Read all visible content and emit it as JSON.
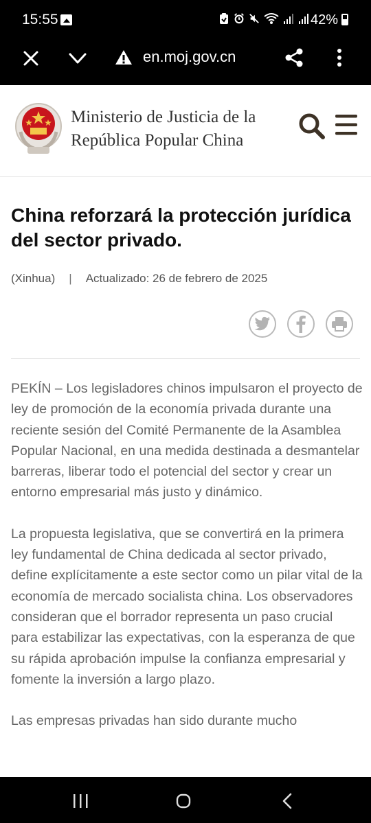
{
  "status_bar": {
    "time": "15:55",
    "battery": "42%"
  },
  "browser": {
    "url": "en.moj.gov.cn"
  },
  "site": {
    "name_line1": "Ministerio de Justicia de la",
    "name_line2": "República Popular China"
  },
  "article": {
    "title": "China reforzará la protección jurídica del sector privado.",
    "source": "(Xinhua)",
    "separator": "|",
    "updated": "Actualizado: 26 de febrero de 2025",
    "paragraphs": [
      "PEKÍN – Los legisladores chinos impulsaron el proyecto de ley de promoción de la economía privada durante una reciente sesión del Comité Permanente de la Asamblea Popular Nacional, en una medida destinada a desmantelar barreras, liberar todo el potencial del sector y crear un entorno empresarial más justo y dinámico.",
      "La propuesta legislativa, que se convertirá en la primera ley fundamental de China dedicada al sector privado, define explícitamente a este sector como un pilar vital de la economía de mercado socialista china. Los observadores consideran que el borrador representa un paso crucial para estabilizar las expectativas, con la esperanza de que su rápida aprobación impulse la confianza empresarial y fomente la inversión a largo plazo.",
      "Las empresas privadas han sido durante mucho"
    ]
  },
  "colors": {
    "system_bar": "#000000",
    "header_icon": "#3d3226",
    "body_text": "#666666",
    "title_text": "#111111"
  }
}
